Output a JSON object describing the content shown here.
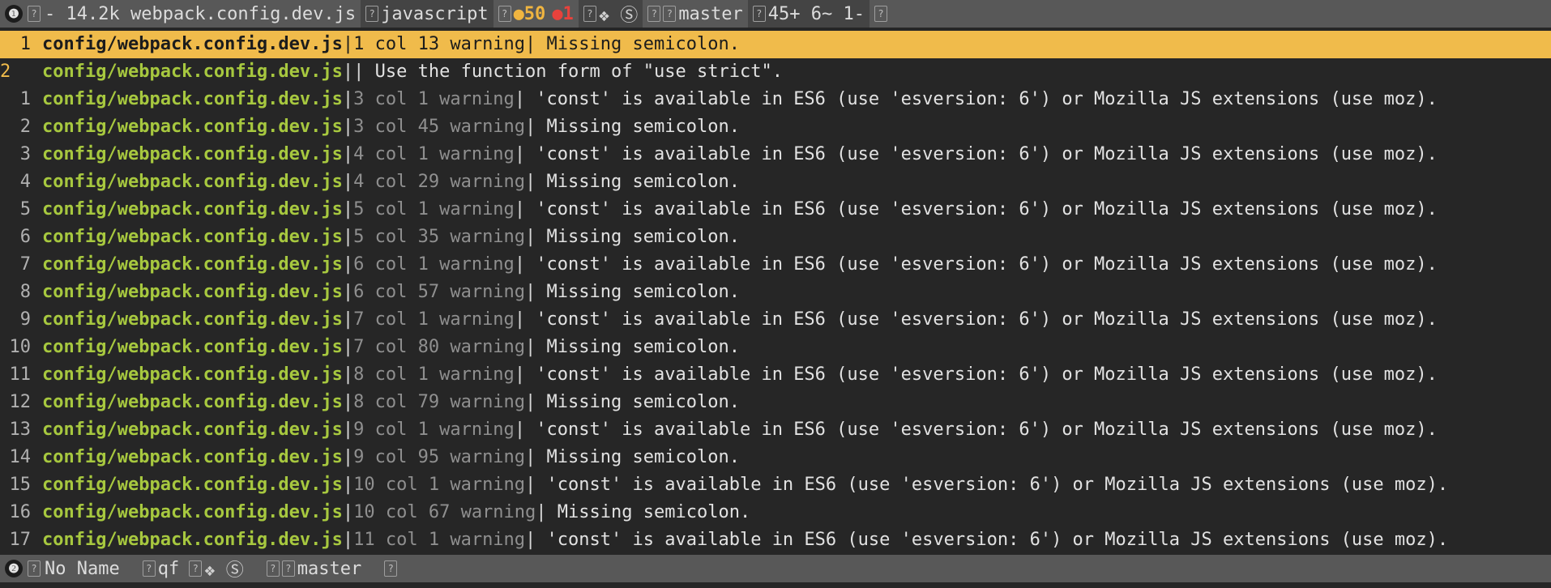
{
  "top_status": {
    "window_number": "❶",
    "mode_glyph": "?",
    "file_info": "- 14.2k webpack.config.dev.js",
    "filetype_glyph": "?",
    "filetype": "javascript",
    "lint_glyph": "?",
    "warnings": "●50",
    "errors": "●1",
    "misc_glyph": "?",
    "misc_symbols": "❖ Ⓢ",
    "branch_glyph_a": "?",
    "branch_glyph_b": "?",
    "branch": "master",
    "diff_glyph": "?",
    "diff_stats": "45+ 6~ 1-",
    "end_glyph": "?"
  },
  "quickfix": {
    "current_marker": "2",
    "rows": [
      {
        "num": "1",
        "file": "config/webpack.config.dev.js",
        "loc": "1 col 13 warning",
        "msg": " Missing semicolon.",
        "current": true
      },
      {
        "num": "2",
        "file": "config/webpack.config.dev.js",
        "loc": "",
        "msg": " Use the function form of \"use strict\".",
        "current": false,
        "cursor": true
      },
      {
        "num": "1",
        "file": "config/webpack.config.dev.js",
        "loc": "3 col 1 warning",
        "msg": " 'const' is available in ES6 (use 'esversion: 6') or Mozilla JS extensions (use moz).",
        "current": false
      },
      {
        "num": "2",
        "file": "config/webpack.config.dev.js",
        "loc": "3 col 45 warning",
        "msg": " Missing semicolon.",
        "current": false
      },
      {
        "num": "3",
        "file": "config/webpack.config.dev.js",
        "loc": "4 col 1 warning",
        "msg": " 'const' is available in ES6 (use 'esversion: 6') or Mozilla JS extensions (use moz).",
        "current": false
      },
      {
        "num": "4",
        "file": "config/webpack.config.dev.js",
        "loc": "4 col 29 warning",
        "msg": " Missing semicolon.",
        "current": false
      },
      {
        "num": "5",
        "file": "config/webpack.config.dev.js",
        "loc": "5 col 1 warning",
        "msg": " 'const' is available in ES6 (use 'esversion: 6') or Mozilla JS extensions (use moz).",
        "current": false
      },
      {
        "num": "6",
        "file": "config/webpack.config.dev.js",
        "loc": "5 col 35 warning",
        "msg": " Missing semicolon.",
        "current": false
      },
      {
        "num": "7",
        "file": "config/webpack.config.dev.js",
        "loc": "6 col 1 warning",
        "msg": " 'const' is available in ES6 (use 'esversion: 6') or Mozilla JS extensions (use moz).",
        "current": false
      },
      {
        "num": "8",
        "file": "config/webpack.config.dev.js",
        "loc": "6 col 57 warning",
        "msg": " Missing semicolon.",
        "current": false
      },
      {
        "num": "9",
        "file": "config/webpack.config.dev.js",
        "loc": "7 col 1 warning",
        "msg": " 'const' is available in ES6 (use 'esversion: 6') or Mozilla JS extensions (use moz).",
        "current": false
      },
      {
        "num": "10",
        "file": "config/webpack.config.dev.js",
        "loc": "7 col 80 warning",
        "msg": " Missing semicolon.",
        "current": false
      },
      {
        "num": "11",
        "file": "config/webpack.config.dev.js",
        "loc": "8 col 1 warning",
        "msg": " 'const' is available in ES6 (use 'esversion: 6') or Mozilla JS extensions (use moz).",
        "current": false
      },
      {
        "num": "12",
        "file": "config/webpack.config.dev.js",
        "loc": "8 col 79 warning",
        "msg": " Missing semicolon.",
        "current": false
      },
      {
        "num": "13",
        "file": "config/webpack.config.dev.js",
        "loc": "9 col 1 warning",
        "msg": " 'const' is available in ES6 (use 'esversion: 6') or Mozilla JS extensions (use moz).",
        "current": false
      },
      {
        "num": "14",
        "file": "config/webpack.config.dev.js",
        "loc": "9 col 95 warning",
        "msg": " Missing semicolon.",
        "current": false
      },
      {
        "num": "15",
        "file": "config/webpack.config.dev.js",
        "loc": "10 col 1 warning",
        "msg": " 'const' is available in ES6 (use 'esversion: 6') or Mozilla JS extensions (use moz).",
        "current": false
      },
      {
        "num": "16",
        "file": "config/webpack.config.dev.js",
        "loc": "10 col 67 warning",
        "msg": " Missing semicolon.",
        "current": false
      },
      {
        "num": "17",
        "file": "config/webpack.config.dev.js",
        "loc": "11 col 1 warning",
        "msg": " 'const' is available in ES6 (use 'esversion: 6') or Mozilla JS extensions (use moz).",
        "current": false
      }
    ]
  },
  "bottom_status": {
    "window_number": "❷",
    "mode_glyph": "?",
    "buffer_name": "No Name",
    "filetype_glyph": "?",
    "filetype": "qf",
    "misc_glyph": "?",
    "misc_symbols": "❖ Ⓢ",
    "branch_glyph_a": "?",
    "branch_glyph_b": "?",
    "branch": "master",
    "end_glyph": "?"
  },
  "colors": {
    "background": "#262626",
    "statusline": "#585858",
    "current_row": "#f0bb4b",
    "filename": "#a7c83f",
    "warning_count": "#f0b540",
    "error_count": "#e8423c"
  }
}
